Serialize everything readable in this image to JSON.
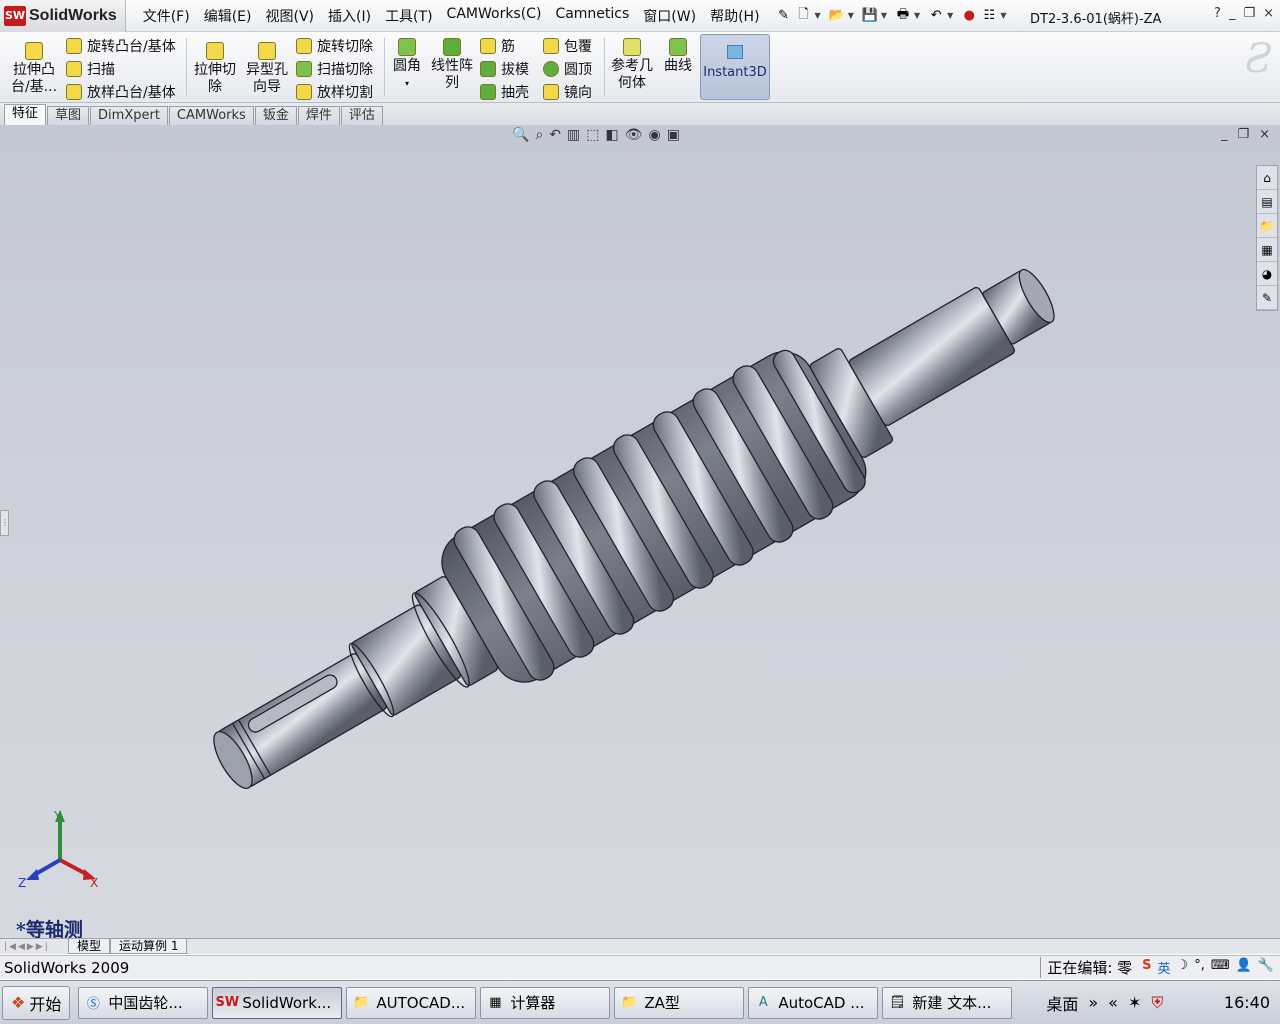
{
  "app": {
    "name": "SolidWorks",
    "logo_text": "SW",
    "document_title": "DT2-3.6-01(蜗杆)-ZA"
  },
  "menu": [
    "文件(F)",
    "编辑(E)",
    "视图(V)",
    "插入(I)",
    "工具(T)",
    "CAMWorks(C)",
    "Camnetics",
    "窗口(W)",
    "帮助(H)"
  ],
  "window_controls": {
    "help": "?",
    "minimize": "_",
    "restore": "❐",
    "close": "×"
  },
  "ribbon": {
    "extrude_boss": "拉伸凸台/基...",
    "revolve_boss": "旋转凸台/基体",
    "sweep": "扫描",
    "loft_boss": "放样凸台/基体",
    "extrude_cut": "拉伸切除",
    "hole_wizard": "异型孔向导",
    "revolve_cut": "旋转切除",
    "sweep_cut": "扫描切除",
    "loft_cut": "放样切割",
    "fillet": "圆角",
    "linear_pattern": "线性阵列",
    "rib": "筋",
    "draft": "拔模",
    "shell": "抽壳",
    "wrap": "包覆",
    "dome": "圆顶",
    "mirror": "镜向",
    "ref_geometry": "参考几何体",
    "curves": "曲线",
    "instant3d": "Instant3D"
  },
  "tabs": [
    {
      "label": "特征",
      "active": true
    },
    {
      "label": "草图"
    },
    {
      "label": "DimXpert"
    },
    {
      "label": "CAMWorks"
    },
    {
      "label": "钣金"
    },
    {
      "label": "焊件"
    },
    {
      "label": "评估"
    }
  ],
  "viewport": {
    "view_name": "*等轴测",
    "triad": {
      "x": "X",
      "y": "Y",
      "z": "Z"
    }
  },
  "model_tabs": [
    "模型",
    "运动算例 1"
  ],
  "status": {
    "app_version": "SolidWorks 2009",
    "editing": "正在编辑: 零",
    "ime": "英"
  },
  "taskbar": {
    "start": "开始",
    "items": [
      {
        "label": "中国齿轮...",
        "icon": "browser-icon"
      },
      {
        "label": "SolidWork...",
        "icon": "solidworks-icon",
        "active": true
      },
      {
        "label": "AUTOCAD...",
        "icon": "folder-icon"
      },
      {
        "label": "计算器",
        "icon": "calculator-icon"
      },
      {
        "label": "ZA型",
        "icon": "folder-icon"
      },
      {
        "label": "AutoCAD ...",
        "icon": "autocad-icon"
      },
      {
        "label": "新建 文本...",
        "icon": "notepad-icon"
      }
    ],
    "desktop": "桌面",
    "clock": "16:40"
  },
  "colors": {
    "viewport_bg": "#c8cbd4",
    "model_metal": "#8a8e9a",
    "accent_red": "#c41b1b"
  }
}
